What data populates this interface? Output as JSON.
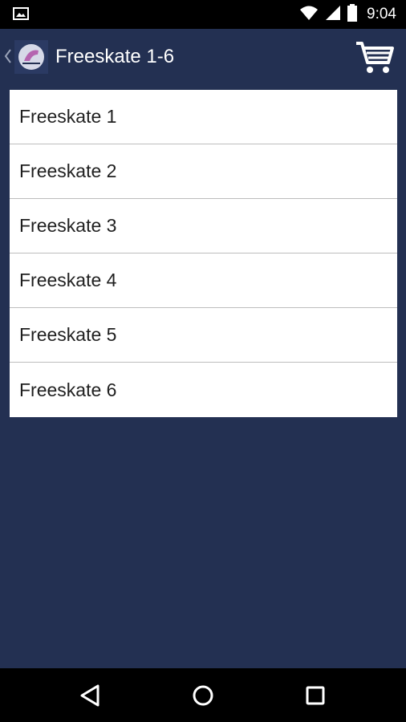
{
  "status_bar": {
    "time": "9:04",
    "icons": [
      "image-notification-icon",
      "wifi-icon",
      "cellular-signal-icon",
      "battery-icon"
    ]
  },
  "app_bar": {
    "title": "Freeskate 1-6",
    "back_icon": "chevron-left-icon",
    "logo_icon": "skate-logo-icon",
    "cart_icon": "shopping-cart-icon"
  },
  "list": {
    "items": [
      {
        "label": "Freeskate 1"
      },
      {
        "label": "Freeskate 2"
      },
      {
        "label": "Freeskate 3"
      },
      {
        "label": "Freeskate 4"
      },
      {
        "label": "Freeskate 5"
      },
      {
        "label": "Freeskate 6"
      }
    ]
  },
  "nav_bar": {
    "buttons": [
      "back-triangle-icon",
      "home-circle-icon",
      "recents-square-icon"
    ]
  },
  "colors": {
    "background": "#233052",
    "status_bar": "#000000",
    "card": "#ffffff",
    "divider": "#bdbdbd"
  }
}
